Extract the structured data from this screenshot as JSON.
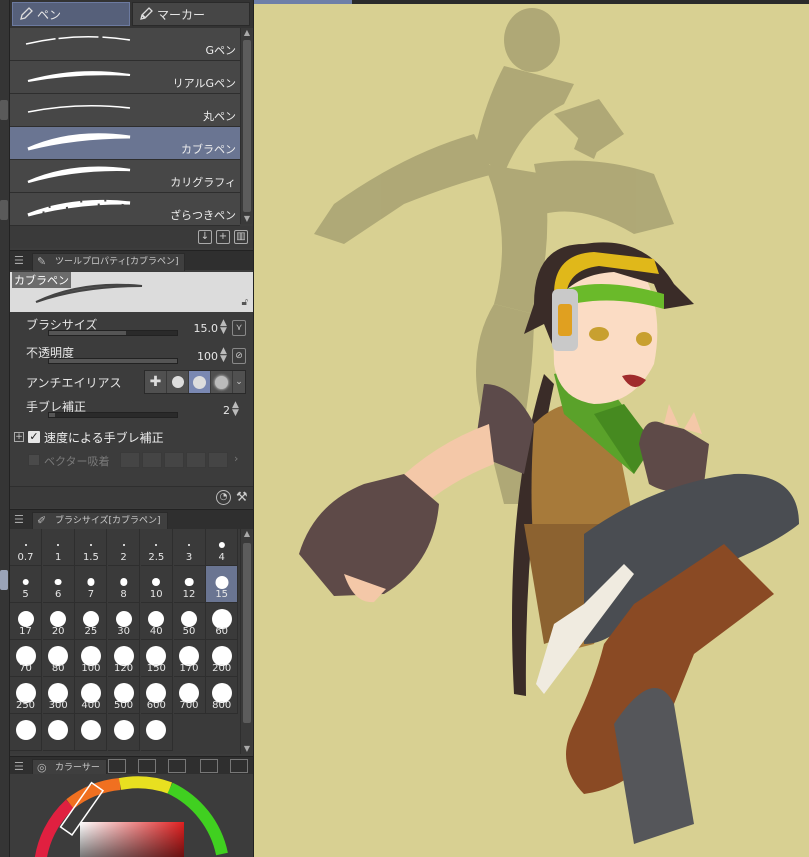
{
  "tabs": [
    {
      "label": "ペン",
      "icon": "pen-icon"
    },
    {
      "label": "マーカー",
      "icon": "marker-icon"
    }
  ],
  "brushes": [
    {
      "name": "Gペン"
    },
    {
      "name": "リアルGペン"
    },
    {
      "name": "丸ペン"
    },
    {
      "name": "カブラペン",
      "selected": true
    },
    {
      "name": "カリグラフィ"
    },
    {
      "name": "ざらつきペン"
    }
  ],
  "tool_property": {
    "tab_label": "ツールプロパティ[カブラペン]",
    "preview_label": "カブラペン",
    "brush_size": {
      "label": "ブラシサイズ",
      "value": "15.0"
    },
    "opacity": {
      "label": "不透明度",
      "value": "100"
    },
    "antialias": {
      "label": "アンチエイリアス",
      "selected_index": 2
    },
    "stabilization": {
      "label": "手ブレ補正",
      "value": "2"
    },
    "speed_stabilization": {
      "label": "速度による手ブレ補正",
      "checked": true
    },
    "vector_snap": {
      "label": "ベクター吸着"
    }
  },
  "brush_size_panel": {
    "tab_label": "ブラシサイズ[カブラペン]",
    "sizes": [
      "0.7",
      "1",
      "1.5",
      "2",
      "2.5",
      "3",
      "4",
      "5",
      "6",
      "7",
      "8",
      "10",
      "12",
      "15",
      "17",
      "20",
      "25",
      "30",
      "40",
      "50",
      "60",
      "70",
      "80",
      "100",
      "120",
      "150",
      "170",
      "200",
      "250",
      "300",
      "400",
      "500",
      "600",
      "700",
      "800",
      "",
      "",
      "",
      "",
      ""
    ],
    "selected": "15"
  },
  "color_panel": {
    "tab_label": "カラーサー"
  },
  "colors": {
    "accent": "#6a7592",
    "canvas_bg": "#d8d092",
    "panel_bg": "#3c3c3c"
  }
}
